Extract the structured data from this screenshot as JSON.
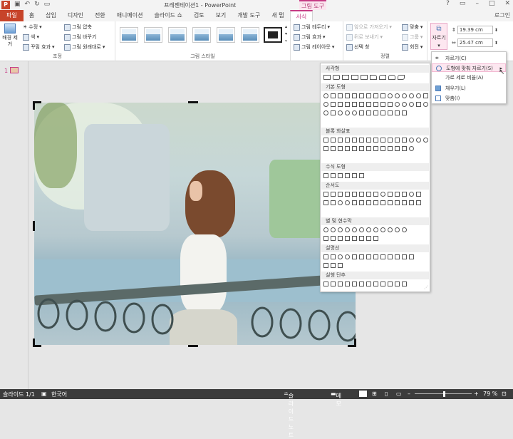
{
  "window": {
    "title": "프레젠테이션1 - PowerPoint",
    "context_group": "그림 도구",
    "login": "로그인"
  },
  "tabs": [
    "파일",
    "홈",
    "삽입",
    "디자인",
    "전환",
    "애니메이션",
    "슬라이드 쇼",
    "검토",
    "보기",
    "개발 도구",
    "새 탭",
    "서식"
  ],
  "ribbon": {
    "adjust": {
      "remove_bg": "배경 제거",
      "correct": "수정",
      "color": "색",
      "artistic": "꾸밈 효과",
      "compress": "그림 압축",
      "change": "그림 바꾸기",
      "reset": "그림 원래대로",
      "label": "조정"
    },
    "styles": {
      "label": "그림 스타일",
      "border": "그림 테두리",
      "effects": "그림 효과",
      "layout": "그림 레이아웃"
    },
    "arrange": {
      "bring_forward": "앞으로 가져오기",
      "send_backward": "뒤로 보내기",
      "selection_pane": "선택 창",
      "align": "맞춤",
      "group": "그룹",
      "rotate": "회전",
      "label": "정렬"
    },
    "size": {
      "crop": "자르기",
      "height": "19.39 cm",
      "width": "25.47 cm"
    }
  },
  "crop_menu": [
    {
      "label": "자르기(C)"
    },
    {
      "label": "도형에 맞춰 자르기(S)"
    },
    {
      "label": "가로 세로 비율(A)"
    },
    {
      "label": "채우기(L)"
    },
    {
      "label": "맞춤(I)"
    }
  ],
  "shape_panel": {
    "sections": [
      "사각형",
      "기본 도형",
      "블록 화살표",
      "수식 도형",
      "순서도",
      "별 및 현수막",
      "설명선",
      "실행 단추"
    ]
  },
  "slide_pane": {
    "number": "1"
  },
  "status": {
    "slide": "슬라이드 1/1",
    "language": "한국어",
    "notes": "슬라이드 노트",
    "memo": "메모",
    "zoom": "79 %"
  }
}
